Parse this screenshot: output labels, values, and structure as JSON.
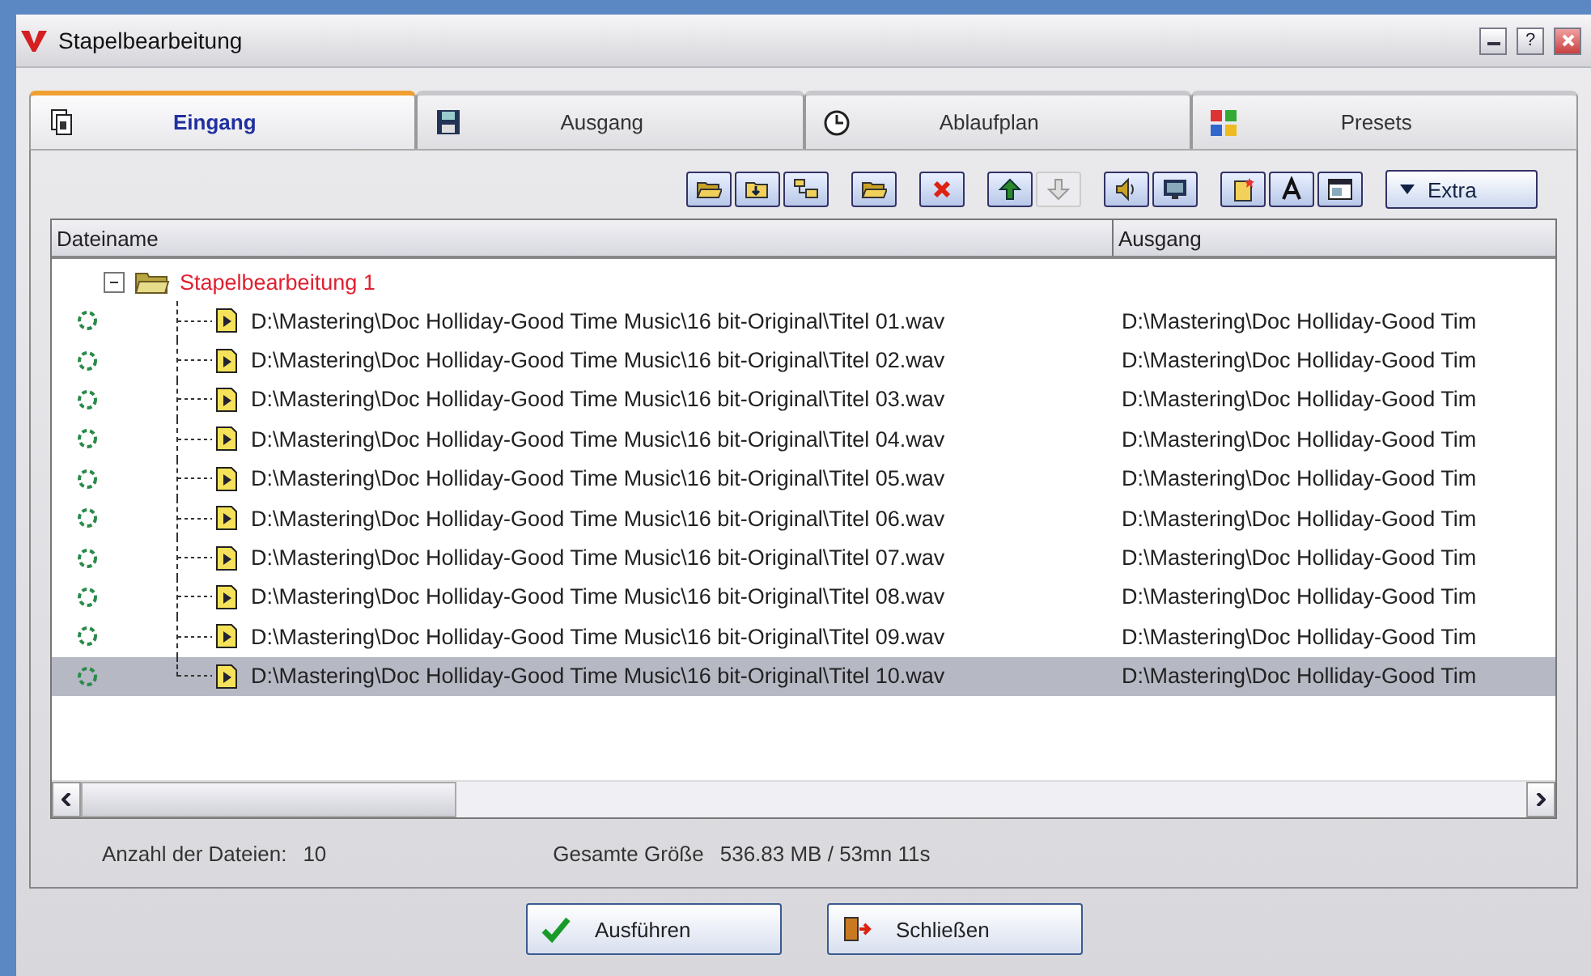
{
  "window": {
    "title": "Stapelbearbeitung",
    "help_label": "?"
  },
  "tabs": [
    {
      "label": "Eingang",
      "kind": "input",
      "selected": true
    },
    {
      "label": "Ausgang",
      "kind": "output",
      "selected": false
    },
    {
      "label": "Ablaufplan",
      "kind": "schedule",
      "selected": false
    },
    {
      "label": "Presets",
      "kind": "presets",
      "selected": false
    }
  ],
  "toolbar": {
    "groups": [
      [
        {
          "kind": "folder-open",
          "disabled": false
        },
        {
          "kind": "folder-add",
          "disabled": false
        },
        {
          "kind": "folder-tree",
          "disabled": false
        }
      ],
      [
        {
          "kind": "folder",
          "disabled": false
        }
      ],
      [
        {
          "kind": "delete",
          "disabled": false
        }
      ],
      [
        {
          "kind": "up",
          "disabled": false
        },
        {
          "kind": "down",
          "disabled": true
        }
      ],
      [
        {
          "kind": "speaker",
          "disabled": false
        },
        {
          "kind": "monitor",
          "disabled": false
        }
      ],
      [
        {
          "kind": "new-file",
          "disabled": false
        },
        {
          "kind": "text",
          "disabled": false
        },
        {
          "kind": "window",
          "disabled": false
        }
      ]
    ],
    "extra": {
      "label": "Extra"
    }
  },
  "file_list": {
    "columns": [
      "Dateiname",
      "Ausgang"
    ],
    "root": {
      "label": "Stapelbearbeitung 1",
      "expanded": true,
      "children": [
        {
          "path": "D:\\Mastering\\Doc Holliday-Good Time Music\\16 bit-Original\\Titel 01.wav",
          "output": "D:\\Mastering\\Doc Holliday-Good Tim",
          "selected": false
        },
        {
          "path": "D:\\Mastering\\Doc Holliday-Good Time Music\\16 bit-Original\\Titel 02.wav",
          "output": "D:\\Mastering\\Doc Holliday-Good Tim",
          "selected": false
        },
        {
          "path": "D:\\Mastering\\Doc Holliday-Good Time Music\\16 bit-Original\\Titel 03.wav",
          "output": "D:\\Mastering\\Doc Holliday-Good Tim",
          "selected": false
        },
        {
          "path": "D:\\Mastering\\Doc Holliday-Good Time Music\\16 bit-Original\\Titel 04.wav",
          "output": "D:\\Mastering\\Doc Holliday-Good Tim",
          "selected": false
        },
        {
          "path": "D:\\Mastering\\Doc Holliday-Good Time Music\\16 bit-Original\\Titel 05.wav",
          "output": "D:\\Mastering\\Doc Holliday-Good Tim",
          "selected": false
        },
        {
          "path": "D:\\Mastering\\Doc Holliday-Good Time Music\\16 bit-Original\\Titel 06.wav",
          "output": "D:\\Mastering\\Doc Holliday-Good Tim",
          "selected": false
        },
        {
          "path": "D:\\Mastering\\Doc Holliday-Good Time Music\\16 bit-Original\\Titel 07.wav",
          "output": "D:\\Mastering\\Doc Holliday-Good Tim",
          "selected": false
        },
        {
          "path": "D:\\Mastering\\Doc Holliday-Good Time Music\\16 bit-Original\\Titel 08.wav",
          "output": "D:\\Mastering\\Doc Holliday-Good Tim",
          "selected": false
        },
        {
          "path": "D:\\Mastering\\Doc Holliday-Good Time Music\\16 bit-Original\\Titel 09.wav",
          "output": "D:\\Mastering\\Doc Holliday-Good Tim",
          "selected": false
        },
        {
          "path": "D:\\Mastering\\Doc Holliday-Good Time Music\\16 bit-Original\\Titel 10.wav",
          "output": "D:\\Mastering\\Doc Holliday-Good Tim",
          "selected": true
        }
      ]
    }
  },
  "summary": {
    "count_label": "Anzahl der Dateien:",
    "count": "10",
    "size_label": "Gesamte Größe",
    "size": "536.83 MB / 53mn 11s"
  },
  "buttons": [
    {
      "label": "Ausführen",
      "kind": "run"
    },
    {
      "label": "Schließen",
      "kind": "close"
    }
  ]
}
